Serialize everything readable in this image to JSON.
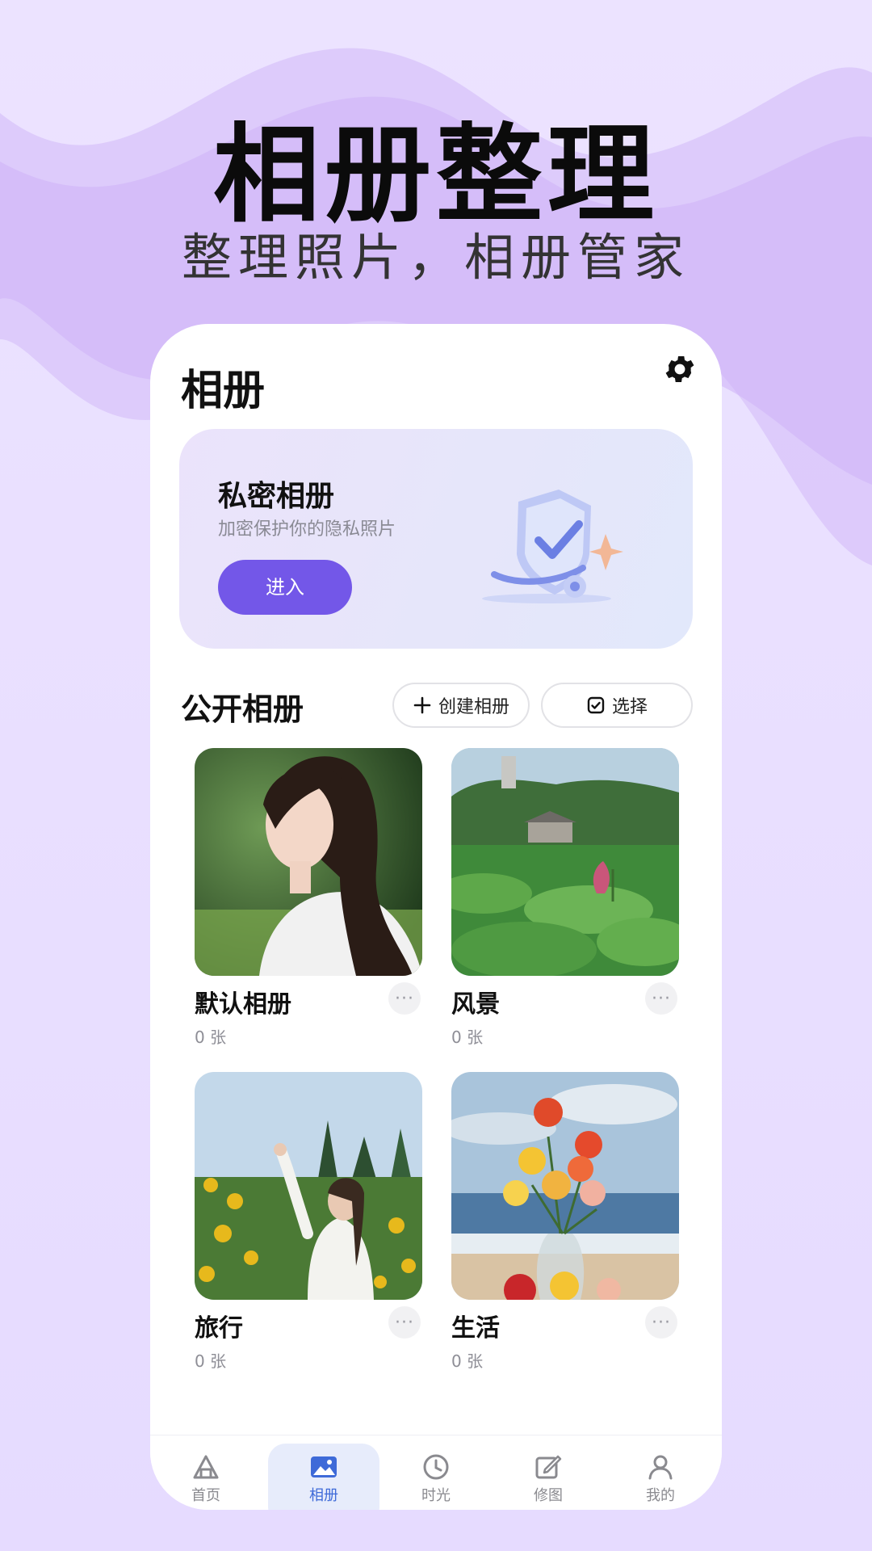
{
  "hero": {
    "title": "相册整理",
    "subtitle": "整理照片，相册管家"
  },
  "header": {
    "title": "相册",
    "settings_icon": "gear-icon"
  },
  "private_album": {
    "title": "私密相册",
    "subtitle": "加密保护你的隐私照片",
    "button": "进入",
    "illustration_icon": "shield-check-icon"
  },
  "public_albums": {
    "title": "公开相册",
    "create_label": "创建相册",
    "select_label": "选择",
    "more_label": "···",
    "items": [
      {
        "name": "默认相册",
        "count": "0 张",
        "image": "portrait-woman-photo"
      },
      {
        "name": "风景",
        "count": "0 张",
        "image": "lotus-pond-landscape-photo"
      },
      {
        "name": "旅行",
        "count": "0 张",
        "image": "sunflower-field-photo"
      },
      {
        "name": "生活",
        "count": "0 张",
        "image": "roses-vase-beach-photo"
      }
    ]
  },
  "tabbar": {
    "items": [
      {
        "label": "首页",
        "icon": "home-icon"
      },
      {
        "label": "相册",
        "icon": "image-icon",
        "active": true
      },
      {
        "label": "时光",
        "icon": "clock-icon"
      },
      {
        "label": "修图",
        "icon": "edit-icon"
      },
      {
        "label": "我的",
        "icon": "user-icon"
      }
    ]
  },
  "colors": {
    "accent": "#7357e8",
    "active_tab": "#3e6ad8",
    "background": "#e7dcff"
  }
}
